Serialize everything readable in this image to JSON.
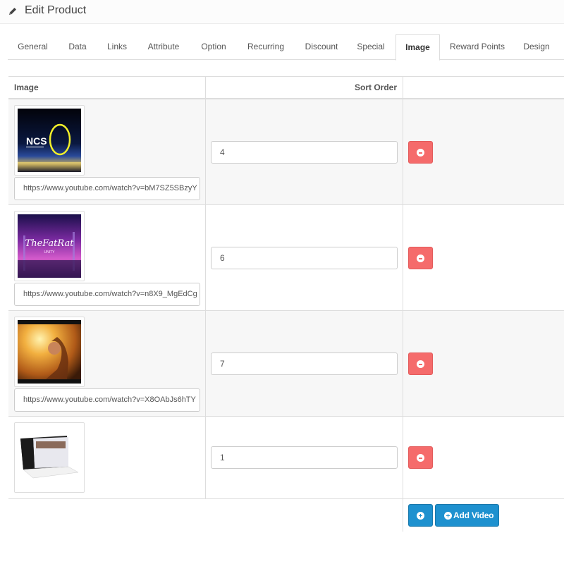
{
  "header": {
    "title": "Edit Product",
    "icon": "pencil-icon"
  },
  "tabs": [
    {
      "label": "General",
      "active": false
    },
    {
      "label": "Data",
      "active": false
    },
    {
      "label": "Links",
      "active": false
    },
    {
      "label": "Attribute",
      "active": false
    },
    {
      "label": "Option",
      "active": false
    },
    {
      "label": "Recurring",
      "active": false
    },
    {
      "label": "Discount",
      "active": false
    },
    {
      "label": "Special",
      "active": false
    },
    {
      "label": "Image",
      "active": true
    },
    {
      "label": "Reward Points",
      "active": false
    },
    {
      "label": "Design",
      "active": false
    }
  ],
  "table": {
    "columns": [
      "Image",
      "Sort Order",
      ""
    ],
    "rows": [
      {
        "thumbnail": "ncs-video-thumbnail",
        "url": "https://www.youtube.com/watch?v=bM7SZ5SBzyY",
        "sort_order": "4"
      },
      {
        "thumbnail": "thefatrat-video-thumbnail",
        "url": "https://www.youtube.com/watch?v=n8X9_MgEdCg",
        "sort_order": "6"
      },
      {
        "thumbnail": "sunset-girl-video-thumbnail",
        "url": "https://www.youtube.com/watch?v=X8OAbJs6hTY",
        "sort_order": "7"
      },
      {
        "thumbnail": "laptop-product-image",
        "url": null,
        "sort_order": "1"
      }
    ]
  },
  "actions": {
    "add_image_icon": "plus-circle-icon",
    "add_video_label": "Add Video"
  },
  "colors": {
    "danger": "#f56b6b",
    "primary": "#1e91cf",
    "active_tab_text": "#333333"
  }
}
